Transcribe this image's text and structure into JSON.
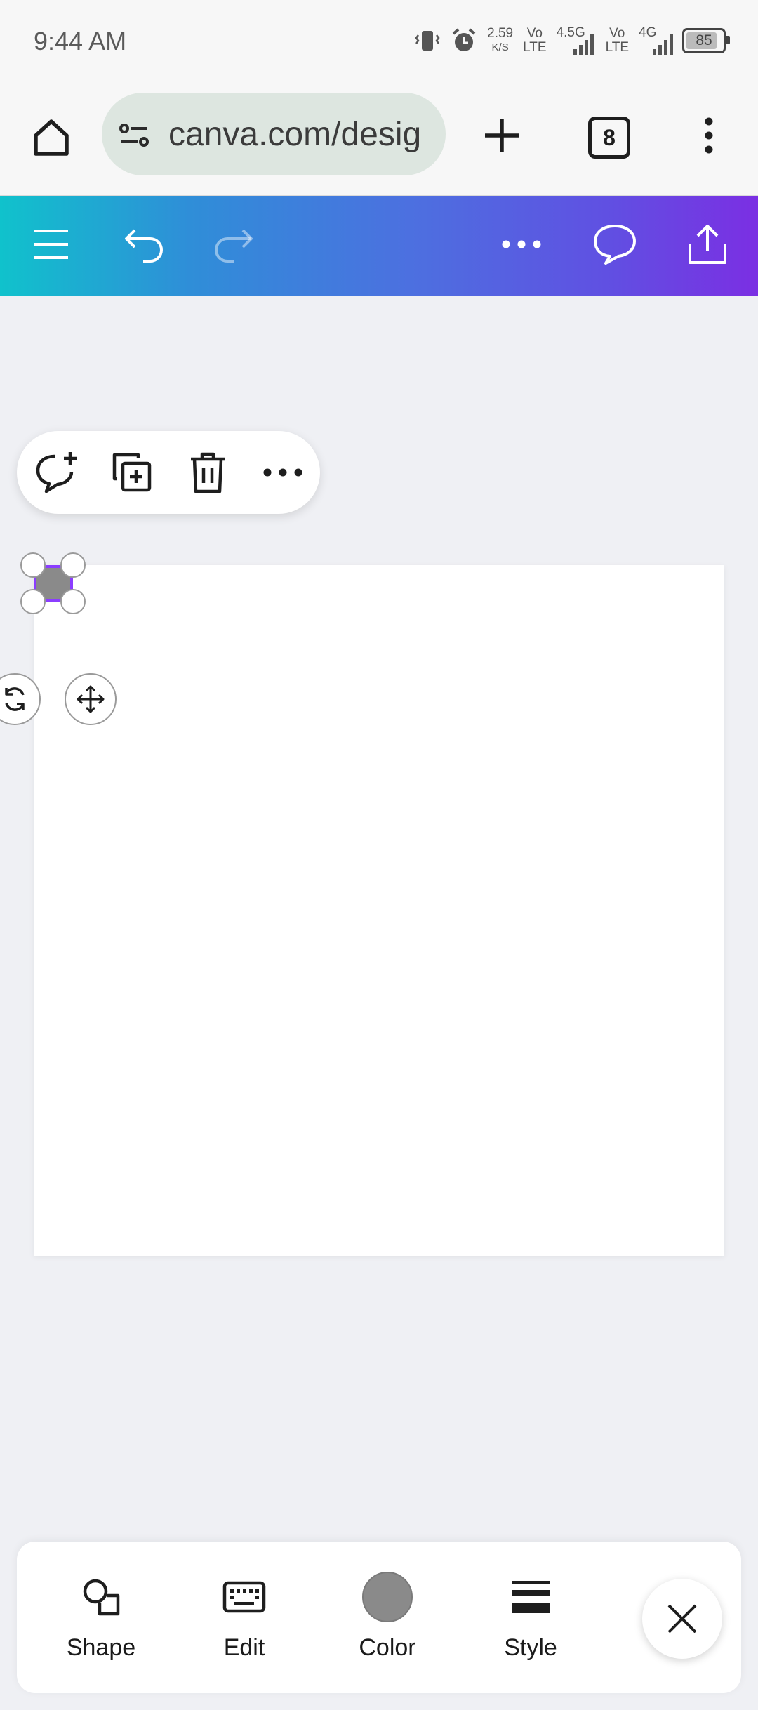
{
  "status_bar": {
    "time": "9:44 AM",
    "net_speed_value": "2.59",
    "net_speed_unit": "K/S",
    "sim1_type": "Vo",
    "sim1_sub": "LTE",
    "sim1_network": "4.5G",
    "sim2_type": "Vo",
    "sim2_sub": "LTE",
    "sim2_network": "4G",
    "battery": "85"
  },
  "browser": {
    "url": "canva.com/desig",
    "tab_count": "8"
  },
  "bottom_toolbar": {
    "shape": "Shape",
    "edit": "Edit",
    "color": "Color",
    "style": "Style"
  },
  "colors": {
    "selection_accent": "#8b3dff",
    "shape_fill": "#8a8a8a",
    "gradient_start": "#10c2cc",
    "gradient_end": "#7b2fe3"
  }
}
